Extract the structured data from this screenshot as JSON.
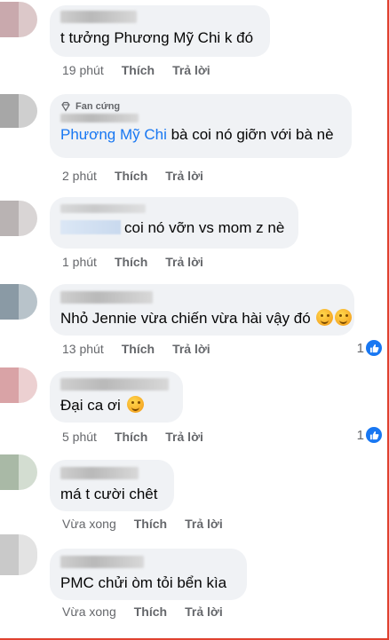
{
  "comments": [
    {
      "badge": "",
      "mention": "",
      "text": "t tưởng Phương Mỹ Chi k đó",
      "emoji_count": 0,
      "time": "19 phút",
      "like_label": "Thích",
      "reply_label": "Trả lời",
      "likes": ""
    },
    {
      "badge": "Fan cứng",
      "mention": "Phương Mỹ Chi",
      "text": "bà coi nó giỡn với bà nè",
      "emoji_count": 0,
      "time": "2 phút",
      "like_label": "Thích",
      "reply_label": "Trả lời",
      "likes": ""
    },
    {
      "badge": "",
      "mention": "",
      "text": "coi nó vỡn vs mom z nè",
      "emoji_count": 0,
      "time": "1 phút",
      "like_label": "Thích",
      "reply_label": "Trả lời",
      "likes": ""
    },
    {
      "badge": "",
      "mention": "",
      "text": "Nhỏ Jennie vừa chiến vừa hài vậy đó",
      "emoji_count": 2,
      "time": "13 phút",
      "like_label": "Thích",
      "reply_label": "Trả lời",
      "likes": "1"
    },
    {
      "badge": "",
      "mention": "",
      "text": "Đại ca ơi",
      "emoji_count": 1,
      "time": "5 phút",
      "like_label": "Thích",
      "reply_label": "Trả lời",
      "likes": "1"
    },
    {
      "badge": "",
      "mention": "",
      "text": "má t cười chêt",
      "emoji_count": 0,
      "time": "Vừa xong",
      "like_label": "Thích",
      "reply_label": "Trả lời",
      "likes": ""
    },
    {
      "badge": "",
      "mention": "",
      "text": "PMC chửi òm tỏi bển kìa",
      "emoji_count": 0,
      "time": "Vừa xong",
      "like_label": "Thích",
      "reply_label": "Trả lời",
      "likes": ""
    }
  ],
  "icons": {
    "badge": "diamond-icon",
    "like": "thumbs-up-icon",
    "emoji": "laughing-emoji-icon"
  },
  "colors": {
    "link": "#1877f2",
    "bubble": "#f0f2f5",
    "meta": "#65676b",
    "border": "#e0412f"
  }
}
